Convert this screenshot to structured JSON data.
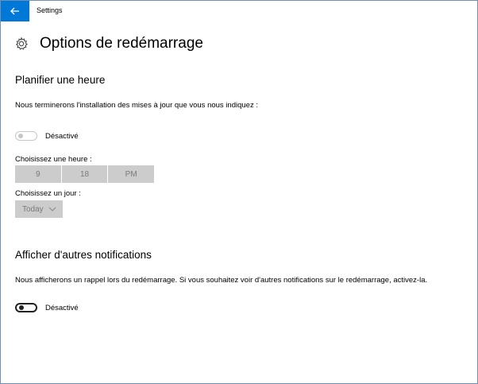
{
  "app": {
    "title": "Settings"
  },
  "page": {
    "title": "Options de redémarrage"
  },
  "schedule": {
    "title": "Planifier une heure",
    "description": "Nous terminerons l'installation des mises à jour que vous nous indiquez :",
    "toggle_label": "Désactivé",
    "time_label": "Choisissez une heure :",
    "time": {
      "hour": "9",
      "minute": "18",
      "period": "PM"
    },
    "day_label": "Choisissez un jour :",
    "day_value": "Today"
  },
  "notifications": {
    "title": "Afficher d'autres notifications",
    "description": "Nous afficherons un rappel lors du redémarrage. Si vous souhaitez voir d'autres notifications sur le redémarrage, activez-la.",
    "toggle_label": "Désactivé"
  },
  "colors": {
    "accent": "#0078d7",
    "disabled_field": "#cccccc",
    "disabled_text": "#7a7a7a"
  },
  "icons": {
    "back": "back-arrow-icon",
    "settings": "gear-icon",
    "dropdown": "chevron-down-icon"
  }
}
